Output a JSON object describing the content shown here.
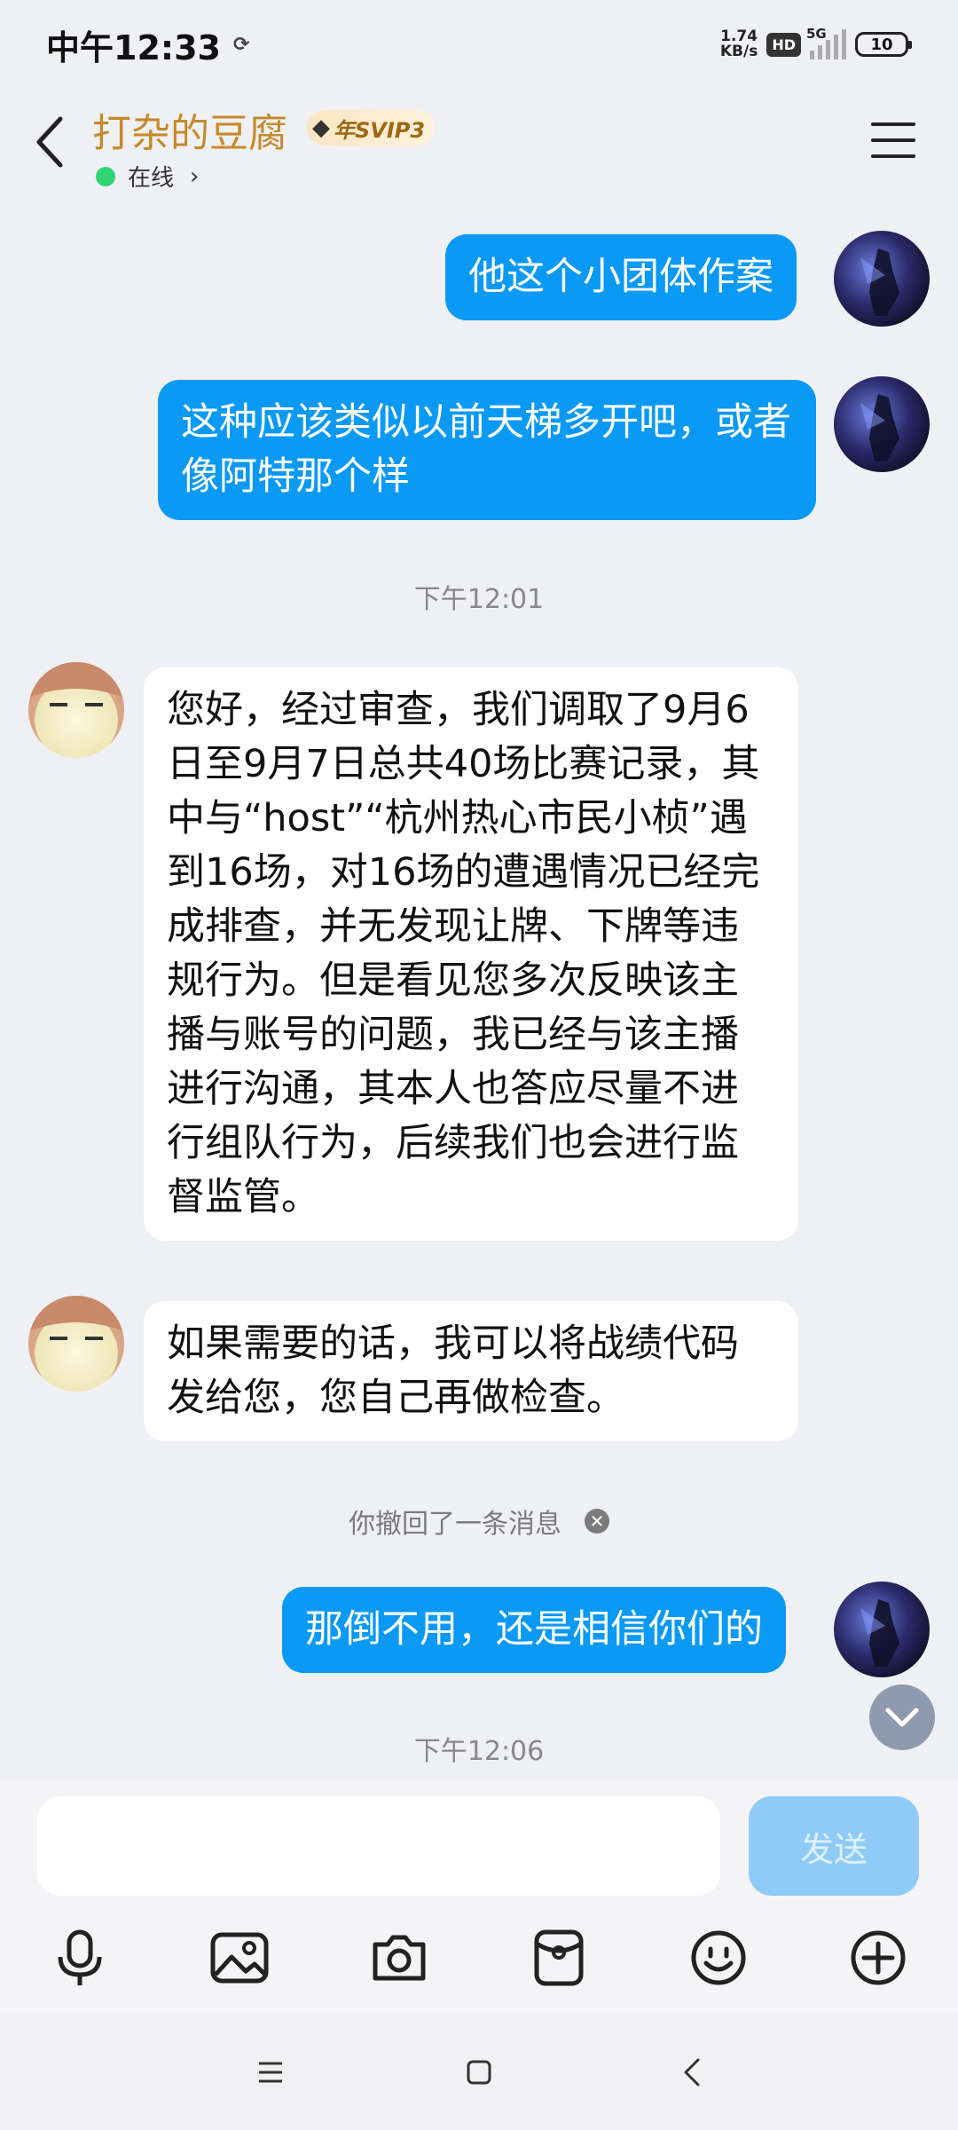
{
  "status": {
    "time": "中午12:33",
    "net_speed_value": "1.74",
    "net_speed_unit": "KB/s",
    "hd": "HD",
    "network": "5G",
    "battery": "10"
  },
  "header": {
    "contact_name": "打杂的豆腐",
    "vip_badge": "年SVIP3",
    "online_status": "在线"
  },
  "messages": [
    {
      "from": "me",
      "text": "他这个小团体作案"
    },
    {
      "from": "me",
      "text": "这种应该类似以前天梯多开吧，或者像阿特那个样"
    },
    {
      "type": "time",
      "text": "下午12:01"
    },
    {
      "from": "them",
      "text": "您好，经过审查，我们调取了9月6日至9月7日总共40场比赛记录，其中与“host”“杭州热心市民小桢”遇到16场，对16场的遭遇情况已经完成排查，并无发现让牌、下牌等违规行为。但是看见您多次反映该主播与账号的问题，我已经与该主播进行沟通，其本人也答应尽量不进行组队行为，后续我们也会进行监督监管。"
    },
    {
      "from": "them",
      "text": "如果需要的话，我可以将战绩代码发给您，您自己再做检查。"
    },
    {
      "type": "recall",
      "text": "你撤回了一条消息"
    },
    {
      "from": "me",
      "text": "那倒不用，还是相信你们的"
    },
    {
      "type": "time",
      "text": "下午12:06"
    }
  ],
  "composer": {
    "input_value": "",
    "send_label": "发送"
  },
  "toolbar_icons": [
    "microphone-icon",
    "image-icon",
    "camera-icon",
    "red-packet-icon",
    "emoji-icon",
    "plus-icon"
  ],
  "colors": {
    "accent_blue": "#0a99f5",
    "name_gold": "#c58a2a",
    "online_green": "#2ed573",
    "background": "#eff0f4"
  }
}
